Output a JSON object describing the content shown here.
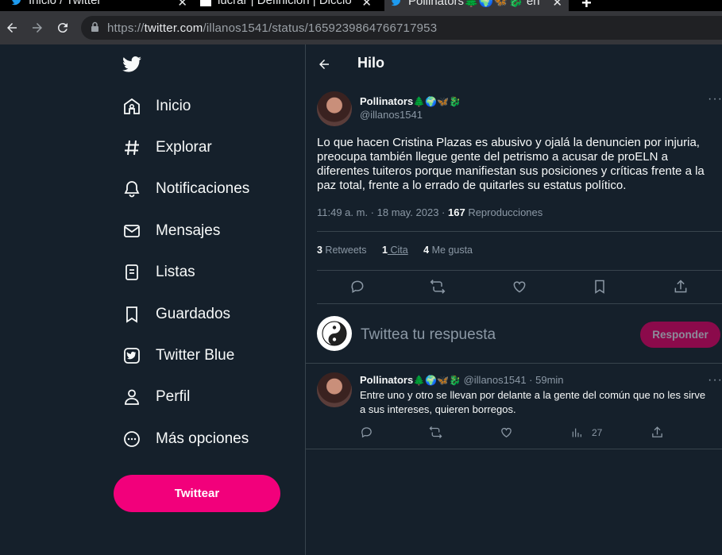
{
  "browser": {
    "tabs": [
      {
        "title": "Inicio / Twitter",
        "active": false
      },
      {
        "title": "lucrar | Definición | Diccio",
        "active": false
      },
      {
        "title": "Pollinators🌲🌍🦋🐉 en",
        "active": true
      }
    ],
    "url_prefix": "https://",
    "url_host": "twitter.com",
    "url_path": "/illanos1541/status/1659239864766717953"
  },
  "sidebar": {
    "items": [
      {
        "label": "Inicio",
        "icon": "home-icon"
      },
      {
        "label": "Explorar",
        "icon": "hashtag-icon"
      },
      {
        "label": "Notificaciones",
        "icon": "bell-icon"
      },
      {
        "label": "Mensajes",
        "icon": "envelope-icon"
      },
      {
        "label": "Listas",
        "icon": "list-icon"
      },
      {
        "label": "Guardados",
        "icon": "bookmark-icon"
      },
      {
        "label": "Twitter Blue",
        "icon": "twitter-blue-icon"
      },
      {
        "label": "Perfil",
        "icon": "person-icon"
      },
      {
        "label": "Más opciones",
        "icon": "more-circle-icon"
      }
    ],
    "tweet_button": "Twittear"
  },
  "header": {
    "title": "Hilo"
  },
  "tweet": {
    "name": "Pollinators",
    "emojis": "🌲🌍🦋🐉",
    "handle": "@illanos1541",
    "text": "Lo que hacen Cristina Plazas es abusivo y ojalá la denuncien por injuria, preocupa también llegue gente del petrismo a acusar de proELN a diferentes tuiteros porque manifiestan sus posiciones y críticas frente a la paz total, frente a lo errado de quitarles su estatus político.",
    "time": "11:49 a. m. · 18 may. 2023 · ",
    "views_count": "167",
    "views_label": " Reproducciones",
    "retweets_count": "3",
    "retweets_label": " Retweets",
    "quotes_count": "1",
    "quotes_label": " Cita",
    "likes_count": "4",
    "likes_label": " Me gusta"
  },
  "reply_box": {
    "placeholder": "Twittea tu respuesta",
    "button": "Responder"
  },
  "comment": {
    "name": "Pollinators",
    "emojis": "🌲🌍🦋🐉",
    "handle": "@illanos1541",
    "time": " · 59min",
    "text": "Entre uno y otro se llevan por delante a la gente del común que no les sirve a sus intereses, quieren borregos.",
    "views": "27"
  },
  "colors": {
    "accent": "#f2007b",
    "background": "#15202b",
    "muted": "#8b98a5"
  }
}
